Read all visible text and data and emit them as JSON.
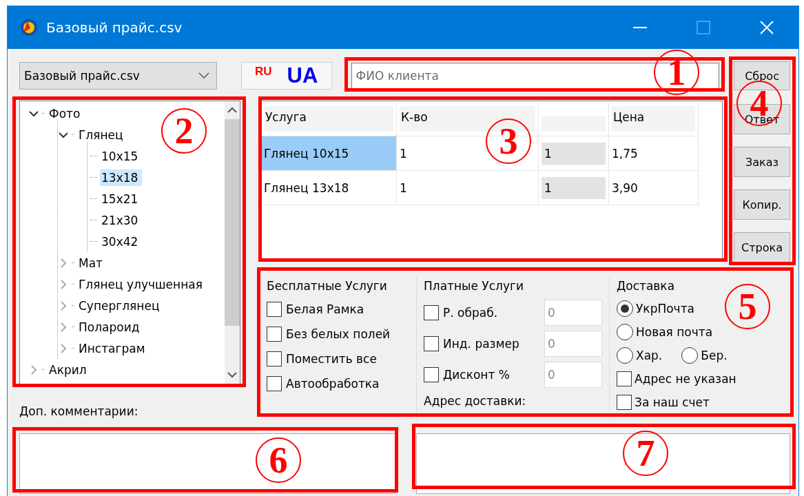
{
  "window": {
    "title": "Базовый прайс.csv"
  },
  "price_select": {
    "value": "Базовый прайс.csv"
  },
  "language_button": {
    "ru": "RU",
    "ua": "UA"
  },
  "client_field": {
    "placeholder": "ФИО клиента"
  },
  "tree": {
    "items": [
      {
        "label": "Фото",
        "expanded": true,
        "selected": false,
        "children": [
          {
            "label": "Глянец",
            "expanded": true,
            "selected": false,
            "children": [
              {
                "label": "10x15",
                "selected": false
              },
              {
                "label": "13x18",
                "selected": true
              },
              {
                "label": "15x21",
                "selected": false
              },
              {
                "label": "21x30",
                "selected": false
              },
              {
                "label": "30x42",
                "selected": false
              }
            ]
          },
          {
            "label": "Мат",
            "expanded": false,
            "selected": false
          },
          {
            "label": "Глянец улучшенная",
            "expanded": false,
            "selected": false
          },
          {
            "label": "Суперглянец",
            "expanded": false,
            "selected": false
          },
          {
            "label": "Полароид",
            "expanded": false,
            "selected": false
          },
          {
            "label": "Инстаграм",
            "expanded": false,
            "selected": false
          }
        ]
      },
      {
        "label": "Акрил",
        "expanded": false,
        "selected": false
      }
    ]
  },
  "table": {
    "columns": [
      {
        "label": "Услуга"
      },
      {
        "label": "К-во"
      },
      {},
      {
        "label": "Цена"
      }
    ],
    "rows": [
      {
        "selected": true,
        "cells": [
          "Глянец 10x15",
          "1",
          "1",
          "1,75"
        ]
      },
      {
        "selected": false,
        "cells": [
          "Глянец 13x18",
          "1",
          "1",
          "3,90"
        ]
      }
    ]
  },
  "side_buttons": [
    "Сброс",
    "Ответ",
    "Заказ",
    "Копир.",
    "Строка"
  ],
  "free_services": {
    "title": "Бесплатные Услуги",
    "items": [
      {
        "label": "Белая Рамка",
        "checked": false
      },
      {
        "label": "Без белых полей",
        "checked": false
      },
      {
        "label": "Поместить все",
        "checked": false
      },
      {
        "label": "Автообработка",
        "checked": false
      }
    ]
  },
  "paid_services": {
    "title": "Платные Услуги",
    "items": [
      {
        "label": "Р. обраб.",
        "checked": false,
        "value": "0",
        "disabled": true
      },
      {
        "label": "Инд. размер",
        "checked": false,
        "value": "0",
        "disabled": true
      },
      {
        "label": "Дисконт %",
        "checked": false,
        "value": "0",
        "disabled": true
      }
    ],
    "address_label": "Адрес доставки:"
  },
  "delivery": {
    "title": "Доставка",
    "rows": [
      {
        "items": [
          {
            "kind": "radio",
            "label": "УкрПочта",
            "selected": true
          }
        ]
      },
      {
        "items": [
          {
            "kind": "radio",
            "label": "Новая почта",
            "selected": false
          }
        ]
      },
      {
        "items": [
          {
            "kind": "radio",
            "label": "Хар.",
            "selected": false
          },
          {
            "kind": "radio",
            "label": "Бер.",
            "selected": false
          }
        ]
      },
      {
        "items": [
          {
            "kind": "checkbox",
            "label": "Адрес не указан",
            "checked": false
          }
        ]
      },
      {
        "items": [
          {
            "kind": "checkbox",
            "label": "За наш счет",
            "checked": false
          }
        ]
      }
    ]
  },
  "comments_label": "Доп. комментарии:",
  "annotations": [
    {
      "number": "1"
    },
    {
      "number": "2"
    },
    {
      "number": "3"
    },
    {
      "number": "4"
    },
    {
      "number": "5"
    },
    {
      "number": "6"
    },
    {
      "number": "7"
    }
  ]
}
